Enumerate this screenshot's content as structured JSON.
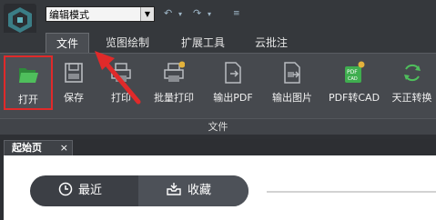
{
  "toolbar": {
    "mode_value": "编辑模式",
    "quick_icons": [
      "back-arrow-icon",
      "chevron-down-icon",
      "forward-arrow-icon",
      "chevron-down-icon",
      "dropdown-icon"
    ]
  },
  "menu_tabs": [
    {
      "label": "文件",
      "active": true
    },
    {
      "label": "览图绘制"
    },
    {
      "label": "扩展工具"
    },
    {
      "label": "云批注"
    }
  ],
  "ribbon": {
    "buttons": [
      {
        "label": "打开",
        "icon": "folder-open-icon"
      },
      {
        "label": "保存",
        "icon": "save-icon"
      },
      {
        "label": "打印",
        "icon": "print-icon"
      },
      {
        "label": "批量打印",
        "icon": "batch-print-icon"
      },
      {
        "label": "输出PDF",
        "icon": "export-pdf-icon"
      },
      {
        "label": "输出图片",
        "icon": "export-image-icon"
      },
      {
        "label": "PDF转CAD",
        "icon": "pdf-to-cad-icon"
      },
      {
        "label": "天正转换",
        "icon": "convert-icon"
      }
    ],
    "group_label": "文件",
    "colors": {
      "highlight": "#e02a2a",
      "open_green": "#3fae4f",
      "vip": "#e3b23c"
    }
  },
  "document_tab": {
    "label": "起始页",
    "close": "×"
  },
  "start": {
    "recent_label": "最近",
    "favorites_label": "收藏"
  }
}
